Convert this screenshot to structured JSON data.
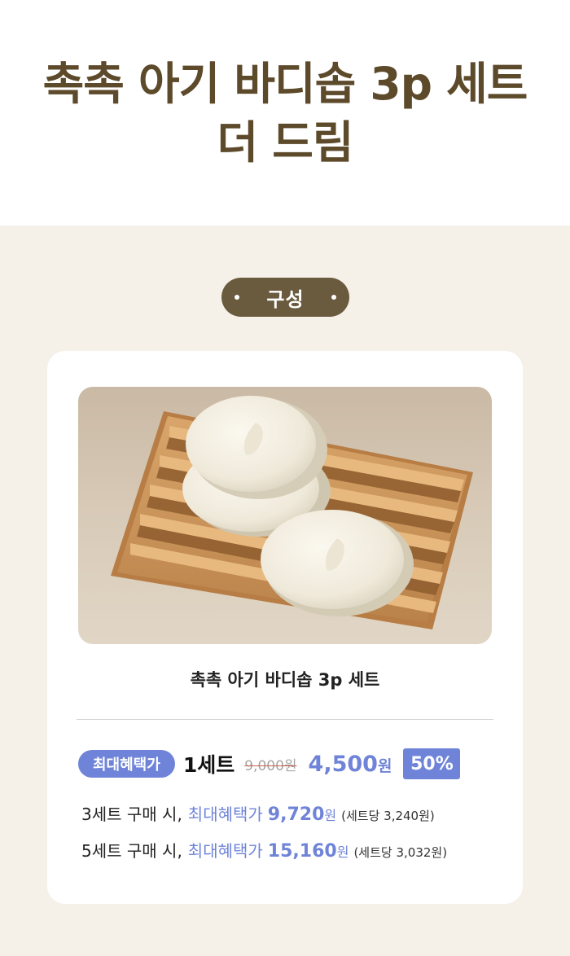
{
  "hero": {
    "title_line1": "촉촉 아기 바디솝 3p 세트",
    "title_line2": "더 드림"
  },
  "section": {
    "pill_label": "구성"
  },
  "product": {
    "image_alt": "wooden soap dish with three round white soaps",
    "name": "촉촉 아기 바디솝 3p 세트"
  },
  "pricing": {
    "badge": "최대혜택가",
    "set_label": "1세트",
    "original_price": "9,000원",
    "sale_price": "4,500",
    "sale_unit": "원",
    "discount": "50%"
  },
  "promos": [
    {
      "prefix": "3세트 구매 시,",
      "accent": "최대혜택가",
      "amount": "9,720",
      "unit": "원",
      "per_set": "(세트당 3,240원)"
    },
    {
      "prefix": "5세트 구매 시,",
      "accent": "최대혜택가",
      "amount": "15,160",
      "unit": "원",
      "per_set": "(세트당 3,032원)"
    }
  ],
  "colors": {
    "title_brown": "#5c4a2a",
    "pill_bg": "#6b5b3e",
    "section_bg": "#f5f0e8",
    "accent_blue": "#6f84d8"
  }
}
